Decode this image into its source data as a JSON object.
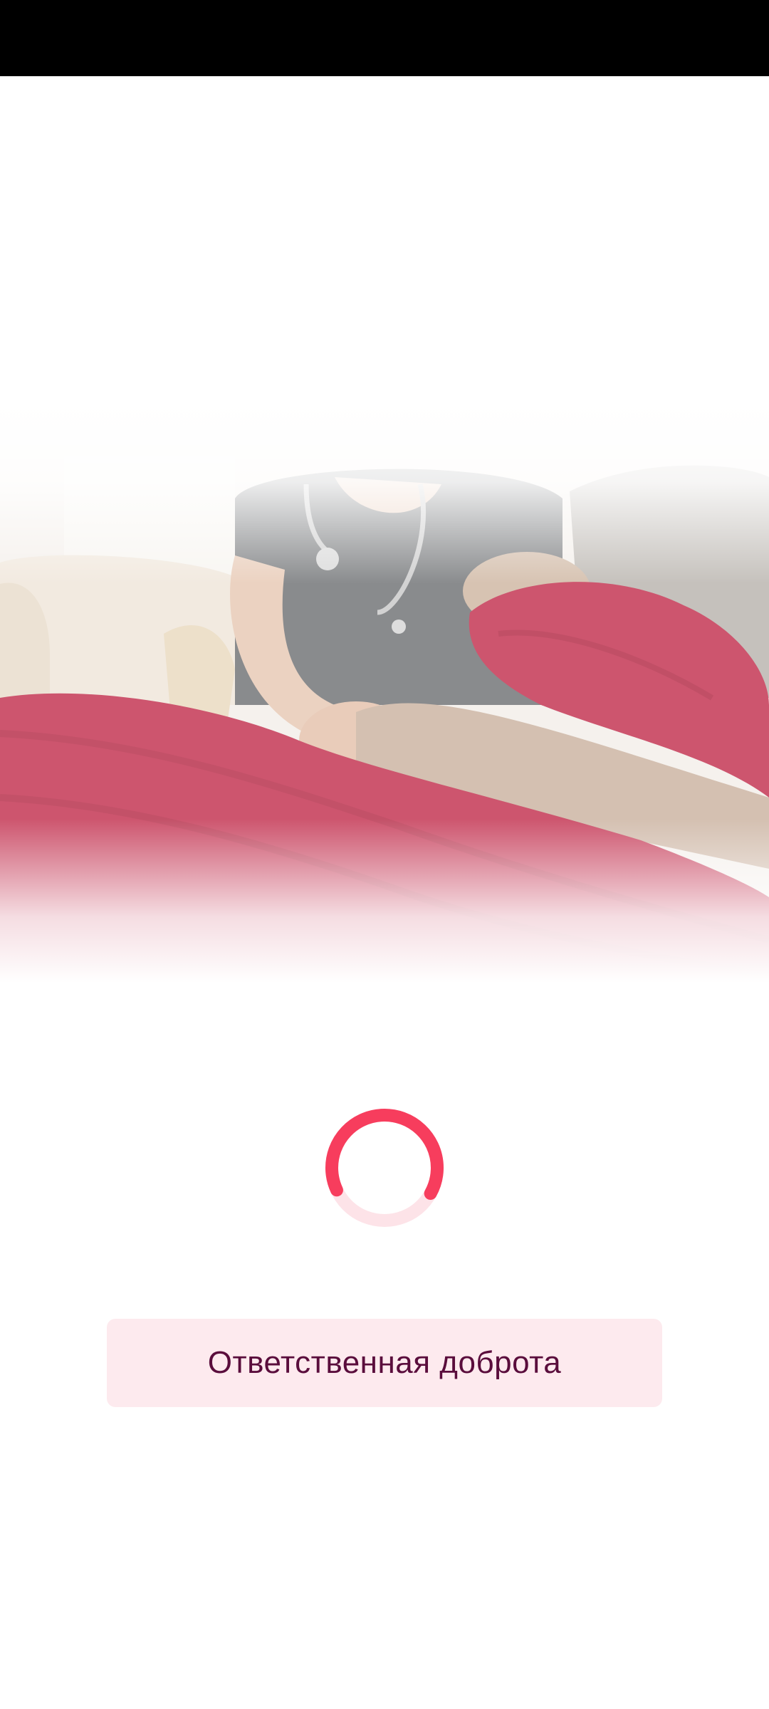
{
  "splash": {
    "tagline": "Ответственная доброта",
    "loading_progress": 0.65
  },
  "colors": {
    "accent": "#f73d5d",
    "accent_track": "#fde3e8",
    "tagline_bg": "#fdeaee",
    "tagline_text": "#5a0d3c",
    "status_bar": "#000000",
    "blanket": "#c2304f"
  },
  "icons": {
    "loader": "loading-spinner-icon"
  }
}
